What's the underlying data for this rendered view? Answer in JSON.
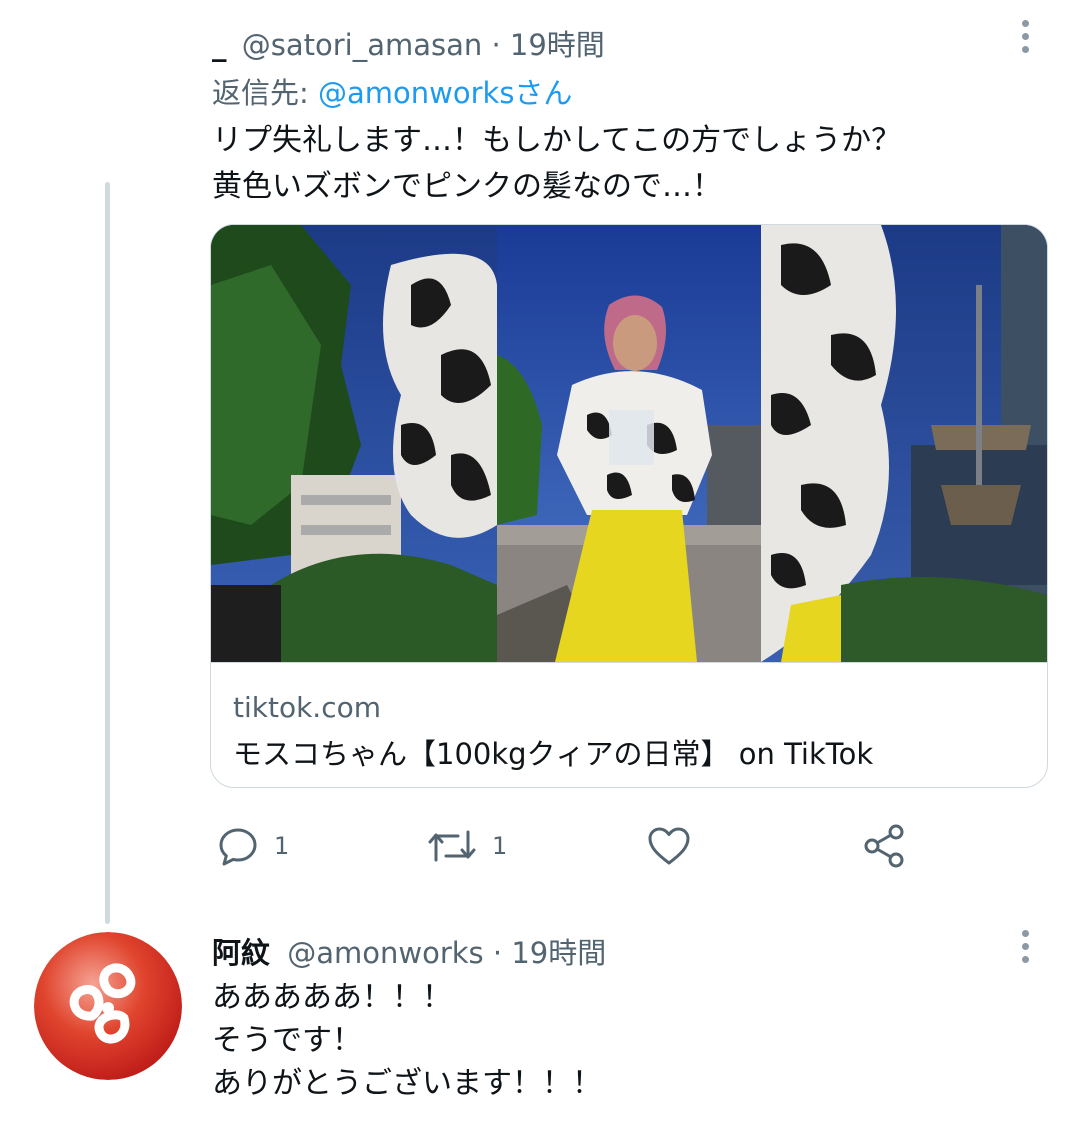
{
  "tweets": [
    {
      "display_name": "_",
      "handle": "@satori_amasan",
      "time": "· 19時間",
      "reply_prefix": "返信先:",
      "reply_to": "@amonworksさん",
      "text_lines": [
        "リプ失礼します…！もしかしてこの方でしょうか？",
        "黄色いズボンでピンクの髪なので…！"
      ],
      "card": {
        "domain": "tiktok.com",
        "title": "モスコちゃん【100kgクィアの日常】 on TikTok"
      },
      "actions": {
        "reply_count": "1",
        "retweet_count": "1"
      }
    },
    {
      "display_name": "阿紋",
      "handle": "@amonworks",
      "time": "· 19時間",
      "text_lines": [
        "あああああ！！！",
        "そうです！",
        "ありがとうございます！！！"
      ]
    }
  ],
  "icons": {
    "more": "more-vertical-icon",
    "reply": "reply-icon",
    "retweet": "retweet-icon",
    "like": "heart-icon",
    "share": "share-icon"
  },
  "colors": {
    "text": "#0f1419",
    "secondary": "#536471",
    "link": "#1d9bf0",
    "border": "#cfd9de",
    "thread_line": "#cfd9de"
  }
}
